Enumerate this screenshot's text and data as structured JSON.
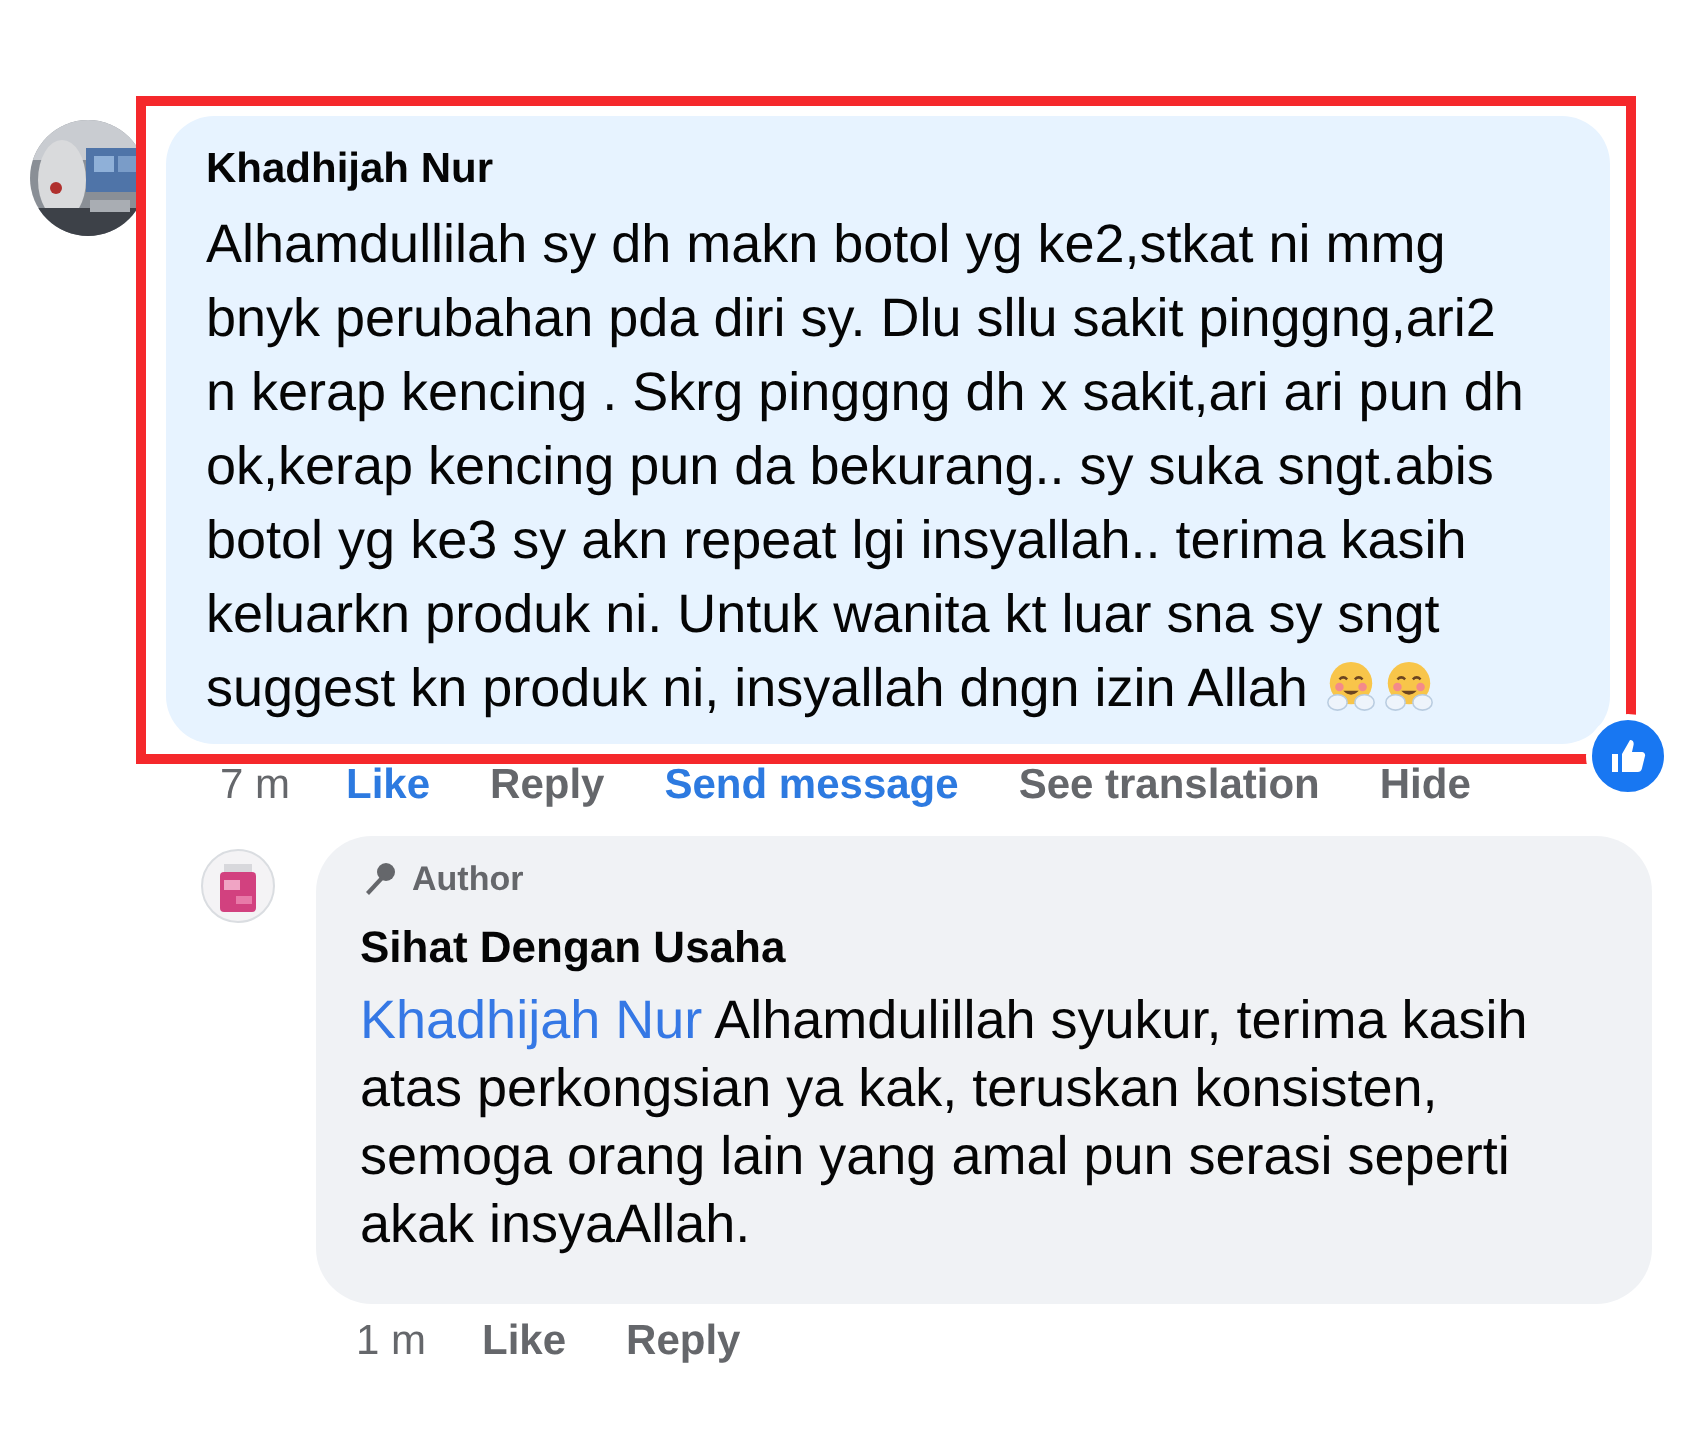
{
  "comment": {
    "highlighted": true,
    "author": "Khadhijah Nur",
    "text_lines": [
      "Alhamdullilah sy dh makn botol yg ke2,stkat ni mmg",
      "bnyk perubahan pda diri sy. Dlu sllu sakit pinggng,ari2",
      "n kerap kencing . Skrg pinggng dh x sakit,ari ari pun dh",
      "ok,kerap kencing pun da bekurang.. sy suka sngt.abis",
      "botol yg ke3 sy akn repeat lgi insyallah.. terima kasih",
      "keluarkn produk ni. Untuk wanita kt luar sna sy sngt",
      "suggest kn produk ni, insyallah dngn izin Allah"
    ],
    "emojis": [
      {
        "kind": "hug"
      },
      {
        "kind": "hug"
      }
    ],
    "reaction": {
      "kind": "like"
    },
    "actions": [
      {
        "kind": "time",
        "label": "7 m"
      },
      {
        "kind": "like",
        "label": "Like",
        "selected": true
      },
      {
        "kind": "action",
        "label": "Reply"
      },
      {
        "kind": "link",
        "label": "Send message"
      },
      {
        "kind": "action",
        "label": "See translation"
      },
      {
        "kind": "action",
        "label": "Hide"
      }
    ]
  },
  "reply": {
    "badge": "Author",
    "author": "Sihat Dengan Usaha",
    "mention": "Khadhijah Nur",
    "text_lines": [
      "Alhamdulillah syukur, terima kasih",
      "atas perkongsian ya kak, teruskan konsisten,",
      "semoga orang lain yang amal pun serasi seperti",
      "akak insyaAllah."
    ],
    "actions": [
      {
        "kind": "time",
        "label": "1 m"
      },
      {
        "kind": "like",
        "label": "Like",
        "selected": false
      },
      {
        "kind": "action",
        "label": "Reply"
      }
    ]
  }
}
